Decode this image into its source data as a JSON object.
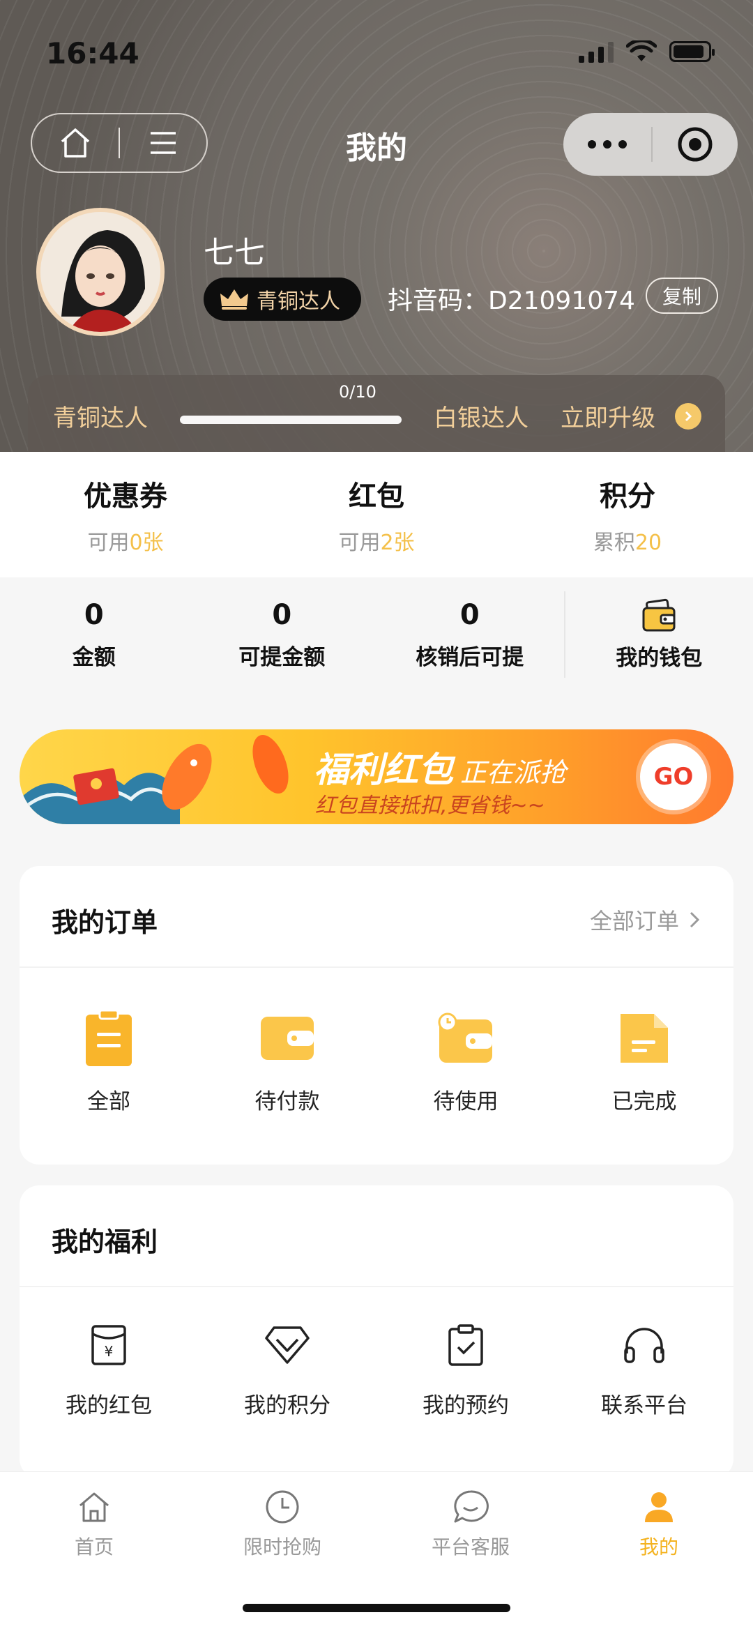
{
  "status": {
    "time": "16:44"
  },
  "nav": {
    "title": "我的"
  },
  "profile": {
    "nickname": "七七",
    "level_badge": "青铜达人",
    "dy_code": "抖音码：D21091074",
    "copy_label": "复制"
  },
  "level_bar": {
    "current": "青铜达人",
    "progress_text": "0/10",
    "progress": 0,
    "next": "白银达人",
    "upgrade": "立即升级"
  },
  "stats": [
    {
      "title": "优惠券",
      "prefix": "可用",
      "value": "0张"
    },
    {
      "title": "红包",
      "prefix": "可用",
      "value": "2张"
    },
    {
      "title": "积分",
      "prefix": "累积",
      "value": "20"
    }
  ],
  "wallet": [
    {
      "value": "0",
      "label": "金额"
    },
    {
      "value": "0",
      "label": "可提金额"
    },
    {
      "value": "0",
      "label": "核销后可提"
    }
  ],
  "wallet_button": {
    "label": "我的钱包"
  },
  "banner": {
    "title": "福利红包",
    "title_suffix": "正在派抢",
    "subtitle": "红包直接抵扣,更省钱~~",
    "go": "GO"
  },
  "orders": {
    "title": "我的订单",
    "more": "全部订单",
    "items": [
      "全部",
      "待付款",
      "待使用",
      "已完成"
    ]
  },
  "benefits": {
    "title": "我的福利",
    "items": [
      "我的红包",
      "我的积分",
      "我的预约",
      "联系平台"
    ]
  },
  "tabbar": {
    "items": [
      "首页",
      "限时抢购",
      "平台客服",
      "我的"
    ],
    "active_index": 3
  },
  "colors": {
    "accent": "#f4b21e",
    "highlight": "#f4c04a",
    "badge_bg": "#0d0d0d"
  }
}
